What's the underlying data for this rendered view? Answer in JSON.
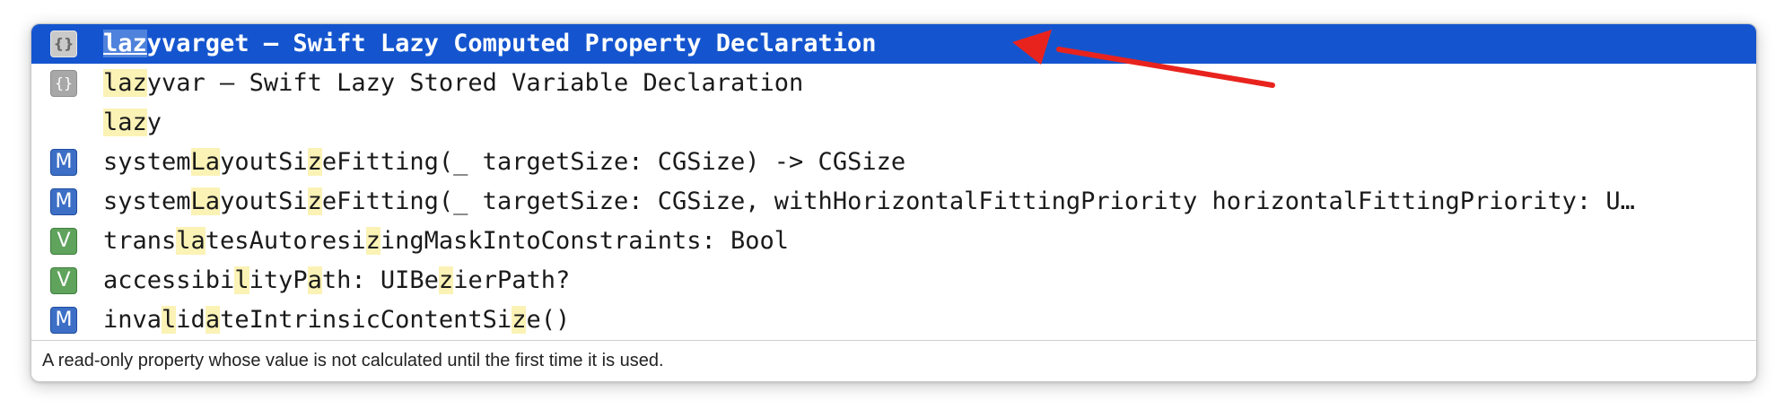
{
  "popup": {
    "rows": [
      {
        "selected": true,
        "icon": "snippet-icon",
        "icon_glyph": "{}",
        "parts": [
          {
            "t": "laz",
            "hl": true
          },
          {
            "t": "yvarget – Swift Lazy Computed Property Declaration",
            "hl": false
          }
        ]
      },
      {
        "selected": false,
        "icon": "snippet-icon",
        "icon_glyph": "{}",
        "parts": [
          {
            "t": "laz",
            "hl": true
          },
          {
            "t": "yvar – Swift Lazy Stored Variable Declaration",
            "hl": false
          }
        ]
      },
      {
        "selected": false,
        "icon": "",
        "icon_glyph": "",
        "parts": [
          {
            "t": "laz",
            "hl": true
          },
          {
            "t": "y",
            "hl": false
          }
        ]
      },
      {
        "selected": false,
        "icon": "method-icon",
        "icon_glyph": "M",
        "parts": [
          {
            "t": "system",
            "hl": false
          },
          {
            "t": "La",
            "hl": true
          },
          {
            "t": "youtSi",
            "hl": false
          },
          {
            "t": "z",
            "hl": true
          },
          {
            "t": "eFitting(_ targetSize: CGSize) -> CGSize",
            "hl": false
          }
        ]
      },
      {
        "selected": false,
        "icon": "method-icon",
        "icon_glyph": "M",
        "parts": [
          {
            "t": "system",
            "hl": false
          },
          {
            "t": "La",
            "hl": true
          },
          {
            "t": "youtSi",
            "hl": false
          },
          {
            "t": "z",
            "hl": true
          },
          {
            "t": "eFitting(_ targetSize: CGSize, withHorizontalFittingPriority horizontalFittingPriority: U…",
            "hl": false
          }
        ]
      },
      {
        "selected": false,
        "icon": "variable-icon",
        "icon_glyph": "V",
        "parts": [
          {
            "t": "trans",
            "hl": false
          },
          {
            "t": "la",
            "hl": true
          },
          {
            "t": "tesAutoresi",
            "hl": false
          },
          {
            "t": "z",
            "hl": true
          },
          {
            "t": "ingMaskIntoConstraints: Bool",
            "hl": false
          }
        ]
      },
      {
        "selected": false,
        "icon": "variable-icon",
        "icon_glyph": "V",
        "parts": [
          {
            "t": "accessibi",
            "hl": false
          },
          {
            "t": "l",
            "hl": true
          },
          {
            "t": "ityP",
            "hl": false
          },
          {
            "t": "a",
            "hl": true
          },
          {
            "t": "th: UIBe",
            "hl": false
          },
          {
            "t": "z",
            "hl": true
          },
          {
            "t": "ierPath?",
            "hl": false
          }
        ]
      },
      {
        "selected": false,
        "icon": "method-icon",
        "icon_glyph": "M",
        "parts": [
          {
            "t": "inva",
            "hl": false
          },
          {
            "t": "l",
            "hl": true
          },
          {
            "t": "id",
            "hl": false
          },
          {
            "t": "a",
            "hl": true
          },
          {
            "t": "teIntrinsicContentSi",
            "hl": false
          },
          {
            "t": "z",
            "hl": true
          },
          {
            "t": "e()",
            "hl": false
          }
        ]
      }
    ],
    "description": "A read-only property whose value is not calculated until the first time it is used."
  },
  "colors": {
    "selection": "#1455cf",
    "match_highlight": "#fbf2b6",
    "method_badge": "#3d6fc6",
    "variable_badge": "#5fa35c",
    "snippet_badge": "#a8a8a8",
    "annotation_arrow": "#e8231e"
  }
}
